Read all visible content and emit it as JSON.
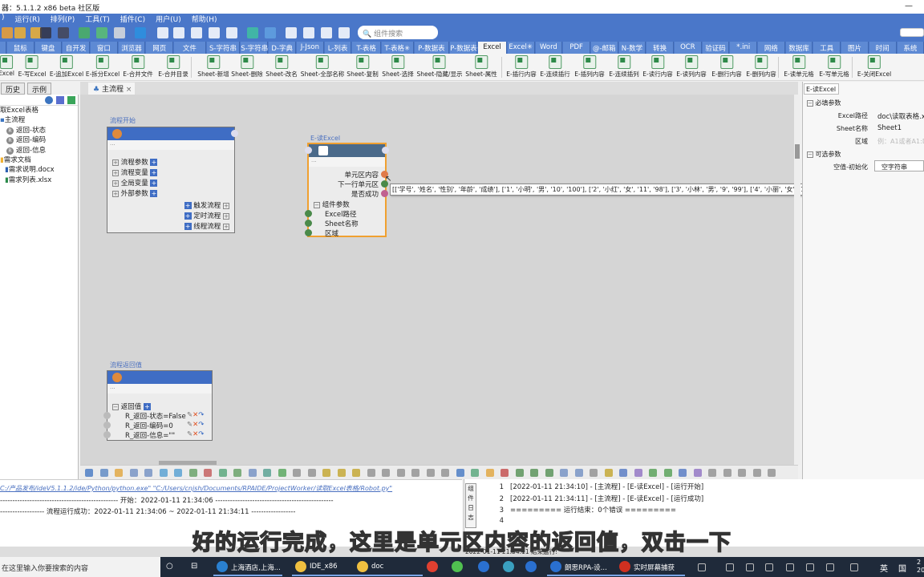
{
  "window": {
    "title": "器：5.1.1.2 x86 beta 社区版",
    "minimize": "—"
  },
  "menu": [
    "运行(R)",
    "排列(P)",
    "工具(T)",
    "插件(C)",
    "用户(U)",
    "帮助(H)"
  ],
  "search": {
    "placeholder": "组件搜索"
  },
  "categories": [
    "鼠标",
    "键盘",
    "自开发",
    "窗口",
    "浏览器",
    "网页",
    "文件",
    "S-字符串",
    "S-字符串✳",
    "D-字典",
    "J-Json",
    "L-列表",
    "T-表格",
    "T-表格✳",
    "P-数据表",
    "P-数据表✳",
    "Excel",
    "Excel✳",
    "Word",
    "PDF",
    "@-邮箱",
    "N-数学",
    "转换",
    "OCR",
    "验证码",
    "*.ini",
    "网络",
    "数据库",
    "工具",
    "图片",
    "时间",
    "系统"
  ],
  "selected_category": "Excel",
  "ribbon": [
    "Excel",
    "E-写Excel",
    "E-追加Excel",
    "E-拆分Excel",
    "E-合并文件",
    "E-合并目录",
    "Sheet-新增",
    "Sheet-删除",
    "Sheet-改名",
    "Sheet-全部名称",
    "Sheet-复制",
    "Sheet-选择",
    "Sheet-隐藏/显示",
    "Sheet-属性",
    "E-插行内容",
    "E-连续插行",
    "E-插列内容",
    "E-连续插列",
    "E-读行内容",
    "E-读列内容",
    "E-删行内容",
    "E-删列内容",
    "E-读单元格",
    "E-写单元格",
    "E-关闭Excel"
  ],
  "panel_tabs": [
    "历史",
    "示例"
  ],
  "tree": {
    "root": "取Excel表格",
    "main": "主流程",
    "returns": [
      "返回-状态",
      "返回-编码",
      "返回-信息"
    ],
    "docs_folder": "需求文档",
    "files": [
      "需求说明.docx",
      "需求列表.xlsx"
    ]
  },
  "doc_tab": {
    "label": "主流程",
    "close": "×"
  },
  "start_node": {
    "title": "流程开始",
    "dots": "...",
    "left_items": [
      "流程参数",
      "流程变量",
      "全局变量",
      "外部参数"
    ],
    "right_items": [
      "触发流程",
      "定时流程",
      "线程流程"
    ]
  },
  "excel_node": {
    "title": "E-读Excel",
    "dots": "...",
    "outputs": [
      "单元区内容",
      "下一行单元区",
      "是否成功"
    ],
    "group": "组件参数",
    "params": [
      "Excel路径",
      "Sheet名称",
      "区域"
    ]
  },
  "tooltip": "[['学号', '姓名', '性别', '年龄', '成绩'], ['1', '小明', '男', '10', '100'], ['2', '小红', '女', '11', '98'], ['3', '小林', '男', '9', '99'], ['4', '小丽', '女', '10', '100']]",
  "return_node": {
    "title": "流程返回值",
    "dots": "...",
    "group": "返回值",
    "items": [
      "R_返回-状态=False",
      "R_返回-编码=0",
      "R_返回-信息=\"\""
    ]
  },
  "properties": {
    "tab": "E-读Excel",
    "required": "必填参数",
    "fields": [
      {
        "label": "Excel路径",
        "value": "doc\\读取表格.xl"
      },
      {
        "label": "Sheet名称",
        "value": "Sheet1"
      },
      {
        "label": "区域",
        "placeholder": "例：A1或者A1:D"
      }
    ],
    "optional": "可选参数",
    "optional_fields": [
      {
        "label": "空值-初始化",
        "value": "空字符串"
      }
    ]
  },
  "log": {
    "command": "C:/产品发布/ideV5.1.1.2/ide/Python/python.exe\"  \"C:/Users/cnjsh/Documents/RPAIDE/ProjectWorker/读取Excel表格/Robot.py\"",
    "start": "------------------------------------------------  开始：2022-01-11 21:34:06  ------------------------------------------------",
    "success": "------------------  流程运行成功：2022-01-11 21:34:06 ~ 2022-01-11 21:34:11  ------------------"
  },
  "component_log": {
    "label": "组件日志",
    "lines": [
      {
        "n": "1",
        "text": "[2022-01-11 21:34:10] - [主流程] - [E-读Excel] - [运行开始]"
      },
      {
        "n": "2",
        "text": "[2022-01-11 21:34:11] - [主流程] - [E-读Excel] - [运行成功]"
      },
      {
        "n": "3",
        "text": "========= 运行结束：0个错误 ========="
      },
      {
        "n": "4",
        "text": ""
      }
    ]
  },
  "status": "2022-01-11 21:34:11 结束运行!",
  "subtitle": "好的运行完成，这里是单元区内容的返回值，双击一下",
  "taskbar": {
    "search_placeholder": "在这里输入你要搜索的内容",
    "apps": [
      "上海酒店,上海...",
      "IDE_x86",
      "doc",
      "朗思RPA-设...",
      "实时屏幕捕获"
    ],
    "tray": {
      "lang": "英",
      "ime": "国",
      "time": "2",
      "date": "202"
    }
  },
  "colors": {
    "accent": "#4a77c9",
    "node_header": "#3f6dc4",
    "excel_node_header": "#4b6a8a",
    "excel_node_border": "#f0a030"
  }
}
